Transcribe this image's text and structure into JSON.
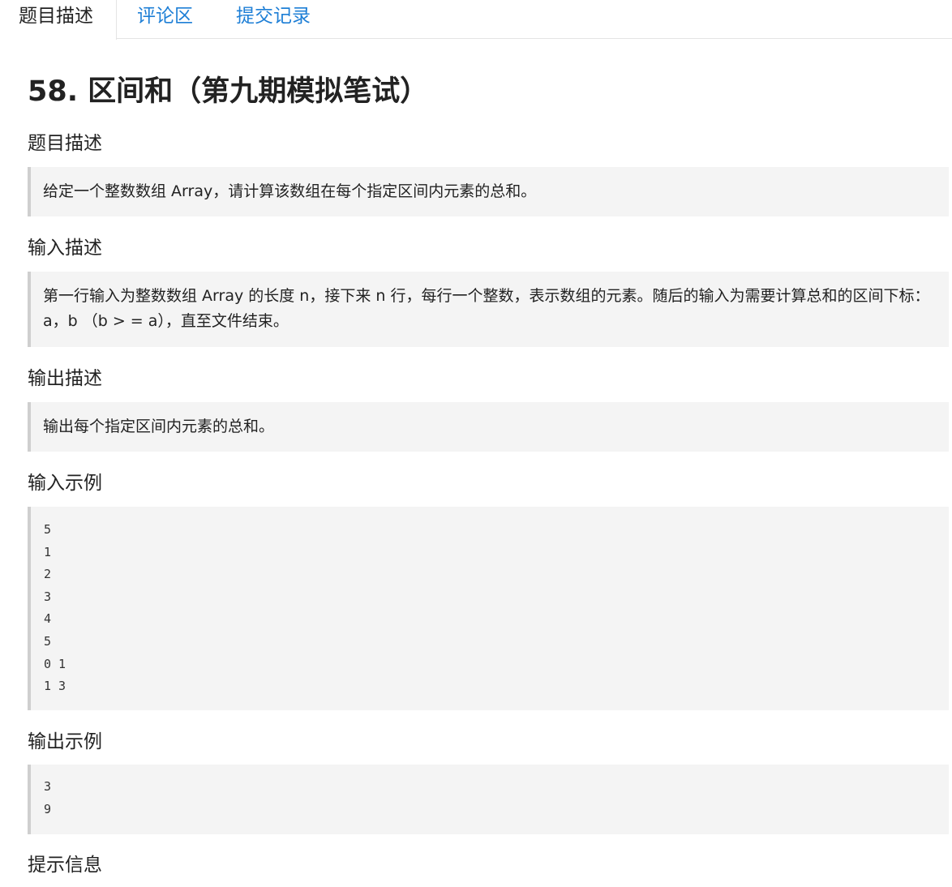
{
  "tabs": [
    {
      "label": "题目描述",
      "active": true
    },
    {
      "label": "评论区",
      "active": false
    },
    {
      "label": "提交记录",
      "active": false
    }
  ],
  "problem": {
    "title": "58. 区间和（第九期模拟笔试）"
  },
  "sections": {
    "description": {
      "heading": "题目描述",
      "text": "给定一个整数数组 Array，请计算该数组在每个指定区间内元素的总和。"
    },
    "input": {
      "heading": "输入描述",
      "text": "第一行输入为整数数组 Array 的长度 n，接下来 n 行，每行一个整数，表示数组的元素。随后的输入为需要计算总和的区间下标：a，b （b > = a），直至文件结束。"
    },
    "output": {
      "heading": "输出描述",
      "text": "输出每个指定区间内元素的总和。"
    },
    "input_example": {
      "heading": "输入示例",
      "lines": [
        "5",
        "1",
        "2",
        "3",
        "4",
        "5",
        "0 1",
        "1 3"
      ]
    },
    "output_example": {
      "heading": "输出示例",
      "lines": [
        "3",
        "9"
      ]
    },
    "hint": {
      "heading": "提示信息"
    }
  },
  "colors": {
    "link": "#1e7fd6",
    "block_background": "#f4f4f4",
    "block_border": "#cfcfcf"
  }
}
